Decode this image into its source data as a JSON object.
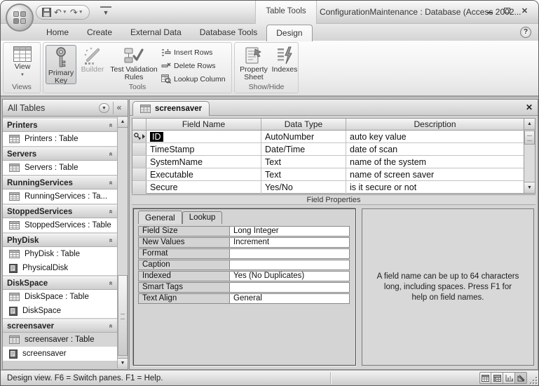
{
  "titlebar": {
    "context_label": "Table Tools",
    "title": "ConfigurationMaintenance : Database (Access 2002...",
    "close_glyph": "✕",
    "help_glyph": "?"
  },
  "qat": {
    "undo_glyph": "↶",
    "redo_glyph": "↷",
    "caret_glyph": "▼",
    "more_glyph": "▼"
  },
  "ribbon": {
    "tabs": [
      "Home",
      "Create",
      "External Data",
      "Database Tools",
      "Design"
    ],
    "views_group": {
      "label": "Views",
      "view_button": "View",
      "view_caret": "▼"
    },
    "tools_group": {
      "label": "Tools",
      "primary_key": "Primary Key",
      "builder": "Builder",
      "test_validation": "Test Validation Rules",
      "insert_rows": "Insert Rows",
      "delete_rows": "Delete Rows",
      "lookup_column": "Lookup Column"
    },
    "show_hide_group": {
      "label": "Show/Hide",
      "property_sheet": "Property Sheet",
      "indexes": "Indexes"
    }
  },
  "sidebar": {
    "title": "All Tables",
    "drop_glyph": "▼",
    "shutter_glyph": "«",
    "chevron_glyph": "«",
    "scroll_up": "▲",
    "scroll_down": "▼",
    "groups": [
      {
        "name": "Printers",
        "items": [
          {
            "label": "Printers : Table"
          }
        ]
      },
      {
        "name": "Servers",
        "items": [
          {
            "label": "Servers : Table"
          }
        ]
      },
      {
        "name": "RunningServices",
        "items": [
          {
            "label": "RunningServices : Ta..."
          }
        ]
      },
      {
        "name": "StoppedServices",
        "items": [
          {
            "label": "StoppedServices : Table"
          }
        ]
      },
      {
        "name": "PhyDisk",
        "items": [
          {
            "label": "PhyDisk : Table"
          },
          {
            "label": "PhysicalDisk"
          }
        ]
      },
      {
        "name": "DiskSpace",
        "items": [
          {
            "label": "DiskSpace : Table"
          },
          {
            "label": "DiskSpace"
          }
        ]
      },
      {
        "name": "screensaver",
        "items": [
          {
            "label": "screensaver : Table"
          },
          {
            "label": "screensaver"
          }
        ]
      }
    ]
  },
  "document": {
    "tab_label": "screensaver",
    "close_glyph": "✕",
    "grid": {
      "columns": [
        "Field Name",
        "Data Type",
        "Description"
      ],
      "scroll_up": "▲",
      "scroll_down": "▼",
      "rows": [
        {
          "field": "ID",
          "type": "AutoNumber",
          "description": "auto key value"
        },
        {
          "field": "TimeStamp",
          "type": "Date/Time",
          "description": "date of scan"
        },
        {
          "field": "SystemName",
          "type": "Text",
          "description": "name of the system"
        },
        {
          "field": "Executable",
          "type": "Text",
          "description": "name of screen saver"
        },
        {
          "field": "Secure",
          "type": "Yes/No",
          "description": "is it secure or not"
        }
      ]
    },
    "field_properties": {
      "label": "Field Properties",
      "tabs": [
        "General",
        "Lookup"
      ],
      "rows": [
        {
          "name": "Field Size",
          "value": "Long Integer"
        },
        {
          "name": "New Values",
          "value": "Increment"
        },
        {
          "name": "Format",
          "value": ""
        },
        {
          "name": "Caption",
          "value": ""
        },
        {
          "name": "Indexed",
          "value": "Yes (No Duplicates)"
        },
        {
          "name": "Smart Tags",
          "value": ""
        },
        {
          "name": "Text Align",
          "value": "General"
        }
      ],
      "help_text": "A field name can be up to 64 characters long, including spaces.  Press F1 for help on field names."
    }
  },
  "statusbar": {
    "text": "Design view. F6 = Switch panes. F1 = Help."
  },
  "colors": {
    "selection_bg": "#000000",
    "selection_fg": "#ffffff",
    "chrome_gray": "#d4d4d4"
  }
}
